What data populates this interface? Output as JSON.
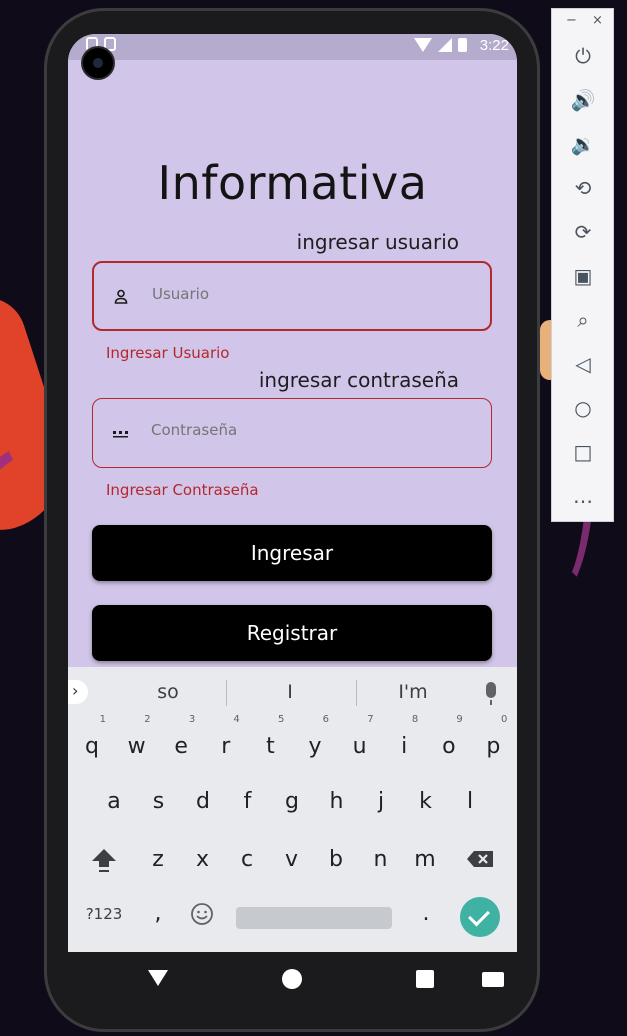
{
  "status_bar": {
    "time": "3:22"
  },
  "app": {
    "title": "Informativa",
    "user_caption": "ingresar usuario",
    "user_placeholder": "Usuario",
    "user_error": "Ingresar Usuario",
    "pass_caption": "ingresar contraseña",
    "pass_placeholder": "Contraseña",
    "pass_error": "Ingresar Contraseña",
    "login_button": "Ingresar",
    "register_button": "Registrar"
  },
  "keyboard": {
    "suggestions": [
      "so",
      "I",
      "I'm"
    ],
    "row1": [
      {
        "k": "q",
        "h": "1"
      },
      {
        "k": "w",
        "h": "2"
      },
      {
        "k": "e",
        "h": "3"
      },
      {
        "k": "r",
        "h": "4"
      },
      {
        "k": "t",
        "h": "5"
      },
      {
        "k": "y",
        "h": "6"
      },
      {
        "k": "u",
        "h": "7"
      },
      {
        "k": "i",
        "h": "8"
      },
      {
        "k": "o",
        "h": "9"
      },
      {
        "k": "p",
        "h": "0"
      }
    ],
    "row2": [
      "a",
      "s",
      "d",
      "f",
      "g",
      "h",
      "j",
      "k",
      "l"
    ],
    "row3": [
      "z",
      "x",
      "c",
      "v",
      "b",
      "n",
      "m"
    ],
    "symbols_key": "?123",
    "comma_key": ",",
    "period_key": "."
  },
  "colors": {
    "screen_bg": "#d1c6e9",
    "error": "#b3282d",
    "button_bg": "#000000",
    "enter_key": "#3fb2a3"
  },
  "toolbar": {
    "minimize": "−",
    "close": "×",
    "items": [
      "power-icon",
      "volume-up-icon",
      "volume-down-icon",
      "rotate-left-icon",
      "rotate-right-icon",
      "camera-icon",
      "zoom-icon",
      "back-icon",
      "home-icon",
      "overview-icon",
      "more-icon"
    ]
  }
}
